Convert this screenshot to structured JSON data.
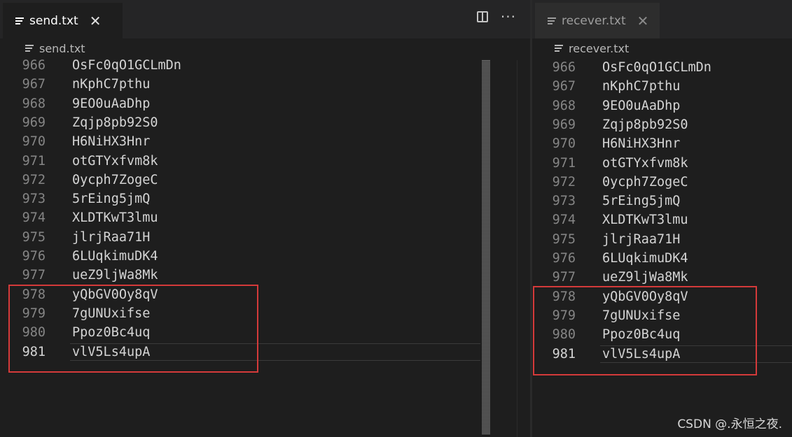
{
  "left": {
    "tab": {
      "label": "send.txt",
      "close": "✕"
    },
    "breadcrumb": "send.txt",
    "lines": [
      {
        "n": "966",
        "text": "OsFc0qO1GCLmDn"
      },
      {
        "n": "967",
        "text": "nKphC7pthu"
      },
      {
        "n": "968",
        "text": "9EO0uAaDhp"
      },
      {
        "n": "969",
        "text": "Zqjp8pb92S0"
      },
      {
        "n": "970",
        "text": "H6NiHX3Hnr"
      },
      {
        "n": "971",
        "text": "otGTYxfvm8k"
      },
      {
        "n": "972",
        "text": "0ycph7ZogeC"
      },
      {
        "n": "973",
        "text": "5rEing5jmQ"
      },
      {
        "n": "974",
        "text": "XLDTKwT3lmu"
      },
      {
        "n": "975",
        "text": "jlrjRaa71H"
      },
      {
        "n": "976",
        "text": "6LUqkimuDK4"
      },
      {
        "n": "977",
        "text": "ueZ9ljWa8Mk"
      },
      {
        "n": "978",
        "text": "yQbGV0Oy8qV"
      },
      {
        "n": "979",
        "text": "7gUNUxifse"
      },
      {
        "n": "980",
        "text": "Ppoz0Bc4uq"
      },
      {
        "n": "981",
        "text": "vlV5Ls4upA"
      }
    ]
  },
  "right": {
    "tab": {
      "label": "recever.txt",
      "close": "✕"
    },
    "breadcrumb": "recever.txt",
    "lines": [
      {
        "n": "966",
        "text": "OsFc0qO1GCLmDn"
      },
      {
        "n": "967",
        "text": "nKphC7pthu"
      },
      {
        "n": "968",
        "text": "9EO0uAaDhp"
      },
      {
        "n": "969",
        "text": "Zqjp8pb92S0"
      },
      {
        "n": "970",
        "text": "H6NiHX3Hnr"
      },
      {
        "n": "971",
        "text": "otGTYxfvm8k"
      },
      {
        "n": "972",
        "text": "0ycph7ZogeC"
      },
      {
        "n": "973",
        "text": "5rEing5jmQ"
      },
      {
        "n": "974",
        "text": "XLDTKwT3lmu"
      },
      {
        "n": "975",
        "text": "jlrjRaa71H"
      },
      {
        "n": "976",
        "text": "6LUqkimuDK4"
      },
      {
        "n": "977",
        "text": "ueZ9ljWa8Mk"
      },
      {
        "n": "978",
        "text": "yQbGV0Oy8qV"
      },
      {
        "n": "979",
        "text": "7gUNUxifse"
      },
      {
        "n": "980",
        "text": "Ppoz0Bc4uq"
      },
      {
        "n": "981",
        "text": "vlV5Ls4upA"
      }
    ]
  },
  "actions": {
    "split_icon": "split-editor-icon",
    "more": "···"
  },
  "colors": {
    "highlight": "#d43a3a",
    "background": "#1e1e1e"
  },
  "watermark": "CSDN @.永恒之夜."
}
